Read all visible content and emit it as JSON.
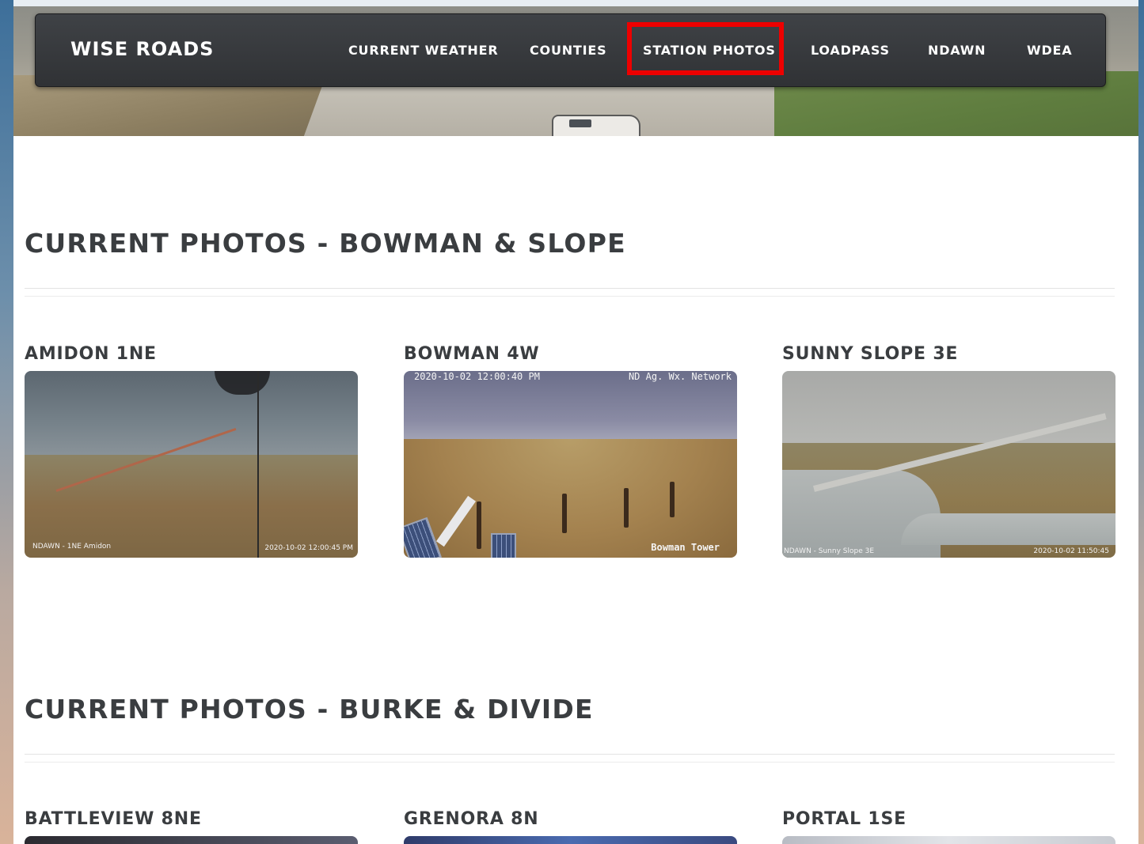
{
  "brand": "WISE ROADS",
  "nav": [
    {
      "label": "CURRENT WEATHER"
    },
    {
      "label": "COUNTIES"
    },
    {
      "label": "STATION PHOTOS"
    },
    {
      "label": "LOADPASS"
    },
    {
      "label": "NDAWN"
    },
    {
      "label": "WDEA"
    }
  ],
  "highlight_color": "#ee0000",
  "sections": [
    {
      "title": "CURRENT PHOTOS - BOWMAN & SLOPE",
      "stations": [
        {
          "name": "AMIDON 1NE",
          "overlay_left": "NDAWN - 1NE Amidon",
          "overlay_right": "2020-10-02 12:00:45 PM"
        },
        {
          "name": "BOWMAN 4W",
          "overlay_top_left": "2020-10-02 12:00:40 PM",
          "overlay_top_right": "ND Ag. Wx. Network",
          "overlay_bottom_right": "Bowman Tower"
        },
        {
          "name": "SUNNY SLOPE 3E",
          "overlay_left": "NDAWN - Sunny Slope 3E",
          "overlay_right": "2020-10-02 11:50:45"
        }
      ]
    },
    {
      "title": "CURRENT PHOTOS - BURKE & DIVIDE",
      "stations": [
        {
          "name": "BATTLEVIEW 8NE"
        },
        {
          "name": "GRENORA 8N"
        },
        {
          "name": "PORTAL 1SE"
        }
      ]
    }
  ]
}
